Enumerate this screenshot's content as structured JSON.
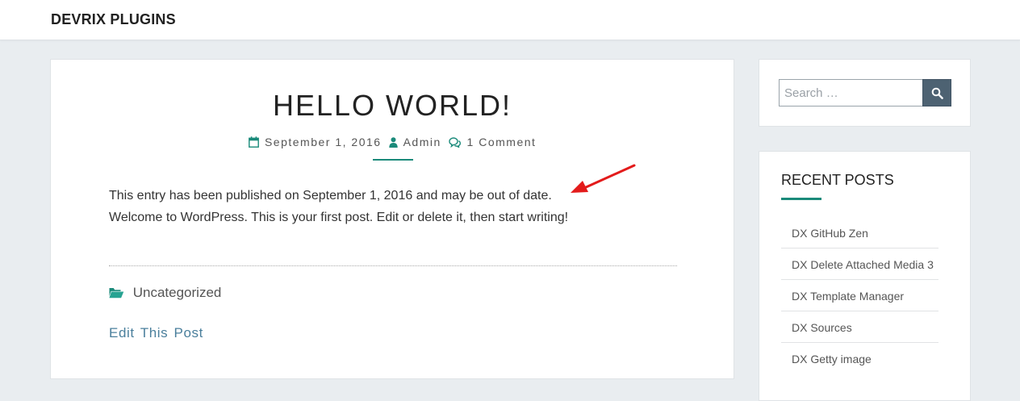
{
  "header": {
    "site_title": "DEVRIX PLUGINS"
  },
  "post": {
    "title": "HELLO WORLD!",
    "meta": {
      "date": "September 1, 2016",
      "author": "Admin",
      "comments": "1 Comment"
    },
    "content": {
      "line1": "This entry has been published on September 1, 2016 and may be out of date.",
      "line2": "Welcome to WordPress. This is your first post. Edit or delete it, then start writing!"
    },
    "category": "Uncategorized",
    "edit_link": "Edit This Post"
  },
  "sidebar": {
    "search": {
      "placeholder": "Search …",
      "button_icon": "search-icon"
    },
    "recent_posts": {
      "title": "RECENT POSTS",
      "items": [
        {
          "label": "DX GitHub Zen"
        },
        {
          "label": "DX Delete Attached Media 3"
        },
        {
          "label": "DX Template Manager"
        },
        {
          "label": "DX Sources"
        },
        {
          "label": "DX Getty image"
        }
      ]
    }
  },
  "colors": {
    "accent": "#1a8a7a",
    "link": "#4a7f9c",
    "search_button": "#4d6272",
    "annotation_arrow": "#e31b1b",
    "background": "#e9edf0"
  },
  "icons": {
    "date": "calendar-icon",
    "author": "user-icon",
    "comments": "comments-icon",
    "category": "folder-open-icon"
  }
}
